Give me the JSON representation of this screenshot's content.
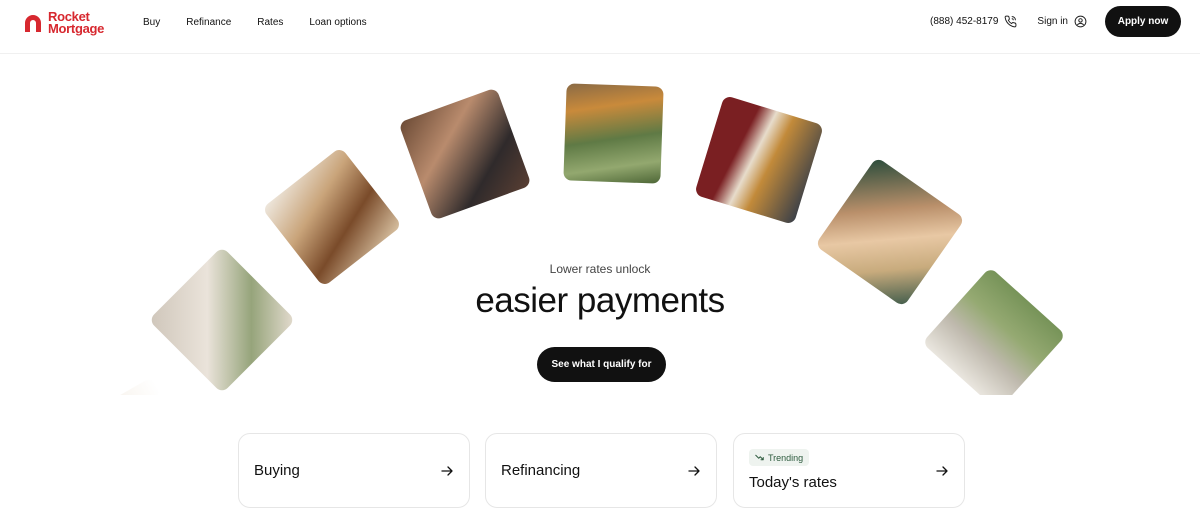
{
  "brand": {
    "name_line1": "Rocket",
    "name_line2": "Mortgage",
    "color": "#d7282f"
  },
  "nav": {
    "items": [
      {
        "label": "Buy"
      },
      {
        "label": "Refinance"
      },
      {
        "label": "Rates"
      },
      {
        "label": "Loan options"
      }
    ]
  },
  "header_right": {
    "phone": "(888) 452-8179",
    "phone_icon": "phone-icon",
    "signin": "Sign in",
    "signin_icon": "user-circle-icon",
    "apply": "Apply now"
  },
  "hero": {
    "kicker": "Lower rates unlock",
    "headline": "easier payments",
    "cta": "See what I qualify for"
  },
  "cards": [
    {
      "label": "Buying",
      "icon": "arrow-right-icon"
    },
    {
      "label": "Refinancing",
      "icon": "arrow-right-icon"
    },
    {
      "label": "Today's rates",
      "badge": "Trending",
      "badge_icon": "trending-icon",
      "icon": "arrow-right-icon"
    }
  ],
  "colors": {
    "primary_button": "#111111",
    "badge_bg": "#eef3ef",
    "badge_text": "#2d5b3e"
  }
}
